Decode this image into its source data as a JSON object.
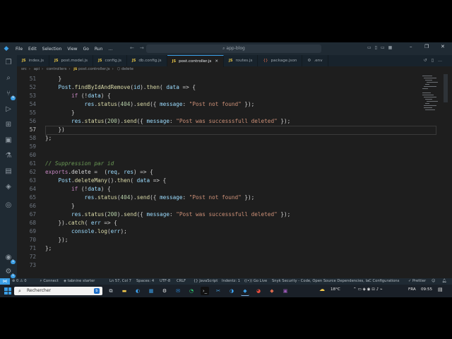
{
  "menu": [
    "File",
    "Edit",
    "Selection",
    "View",
    "Go",
    "Run",
    "…"
  ],
  "command_center": {
    "text": "app-blog"
  },
  "tabs": [
    {
      "label": "index.js",
      "kind": "js",
      "active": false
    },
    {
      "label": "post.model.js",
      "kind": "js",
      "active": false
    },
    {
      "label": "config.js",
      "kind": "js",
      "active": false
    },
    {
      "label": "db.config.js",
      "kind": "js",
      "active": false
    },
    {
      "label": "post.controller.js",
      "kind": "js",
      "active": true
    },
    {
      "label": "routes.js",
      "kind": "js",
      "active": false
    },
    {
      "label": "package.json",
      "kind": "json",
      "active": false
    },
    {
      "label": ".env",
      "kind": "env",
      "active": false
    }
  ],
  "breadcrumb": [
    "src",
    "api",
    "controllers",
    "post.controller.js",
    "delete"
  ],
  "js_badge": "JS",
  "activity_badges": {
    "source_control": "9",
    "accounts": "1",
    "settings": "1"
  },
  "editor": {
    "current_line": 57,
    "lines": [
      {
        "n": "51",
        "text": "    }"
      },
      {
        "n": "52",
        "text": "    Post.findByIdAndRemove(id).then( data => {"
      },
      {
        "n": "53",
        "text": "        if (!data) {"
      },
      {
        "n": "54",
        "text": "            res.status(404).send({ message: \"Post not found\" });"
      },
      {
        "n": "55",
        "text": "        }"
      },
      {
        "n": "56",
        "text": "        res.status(200).send({ message: \"Post was successsfull deleted\" });"
      },
      {
        "n": "57",
        "text": "    })"
      },
      {
        "n": "58",
        "text": "};"
      },
      {
        "n": "59",
        "text": ""
      },
      {
        "n": "60",
        "text": ""
      },
      {
        "n": "61",
        "text": "// Suppression par id"
      },
      {
        "n": "62",
        "text": "exports.delete =  (req, res) => {"
      },
      {
        "n": "63",
        "text": "    Post.deleteMany().then( data => {"
      },
      {
        "n": "64",
        "text": "        if (!data) {"
      },
      {
        "n": "65",
        "text": "            res.status(404).send({ message: \"Post not found\" });"
      },
      {
        "n": "66",
        "text": "        }"
      },
      {
        "n": "67",
        "text": "        res.status(200).send({ message: \"Post was successsfull deleted\" });"
      },
      {
        "n": "68",
        "text": "    }).catch( err => {"
      },
      {
        "n": "69",
        "text": "        console.log(err);"
      },
      {
        "n": "70",
        "text": "    });"
      },
      {
        "n": "71",
        "text": "};"
      },
      {
        "n": "72",
        "text": ""
      },
      {
        "n": "73",
        "text": ""
      }
    ]
  },
  "statusbar": {
    "problems": "⊗ 0 ⚠ 0",
    "connect": "Connect",
    "tabnine": "tabnine starter",
    "position": "Ln 57, Col 7",
    "spaces": "Spaces: 4",
    "encoding": "UTF-8",
    "eol": "CRLF",
    "language": "{} JavaScript",
    "indentz": "Indentz: 1",
    "golive": "Go Live",
    "snyk": "Snyk Security - Code, Open Source Dependencies, IaC Configurations",
    "prettier": "✓ Prettier"
  },
  "taskbar": {
    "search_placeholder": "Rechercher",
    "weather": "18°C",
    "language": "FRA",
    "time": "09:55"
  },
  "colors": {
    "accent": "#3b9fe6",
    "keyword": "#c586c0",
    "function": "#dcdcaa",
    "string": "#ce9178",
    "number": "#b5cea8",
    "variable": "#9cdcfe",
    "comment": "#6a9955"
  }
}
